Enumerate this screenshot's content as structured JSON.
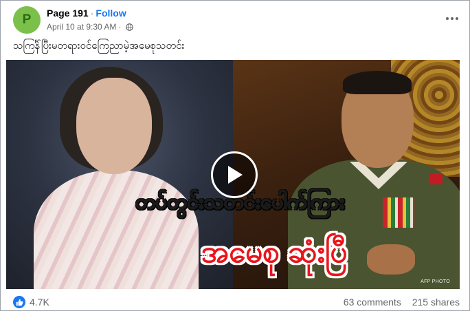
{
  "post": {
    "author": {
      "avatar_letter": "P",
      "name": "Page 191",
      "separator": "·",
      "follow_label": "Follow"
    },
    "meta": {
      "timestamp": "April 10 at 9:30 AM",
      "separator": "·",
      "privacy_icon": "globe-icon"
    },
    "text": "သကြင်္န်ပြီးမတရားဝင်ကြေညာမဲ့အမေစုသတင်း",
    "video": {
      "caption_line1": "တပ်တွင်းသတင်းပေါက်ကြား",
      "caption_line2": "အမေစု ဆုံးပြီ",
      "credit": "AFP PHOTO",
      "play_icon": "play-icon"
    },
    "stats": {
      "reactions": "4.7K",
      "comments": "63 comments",
      "shares": "215 shares"
    }
  },
  "colors": {
    "accent": "#1877f2",
    "avatar": "#7bc04a",
    "caption_yellow": "#ffe41a",
    "caption_red": "#e8151c"
  }
}
